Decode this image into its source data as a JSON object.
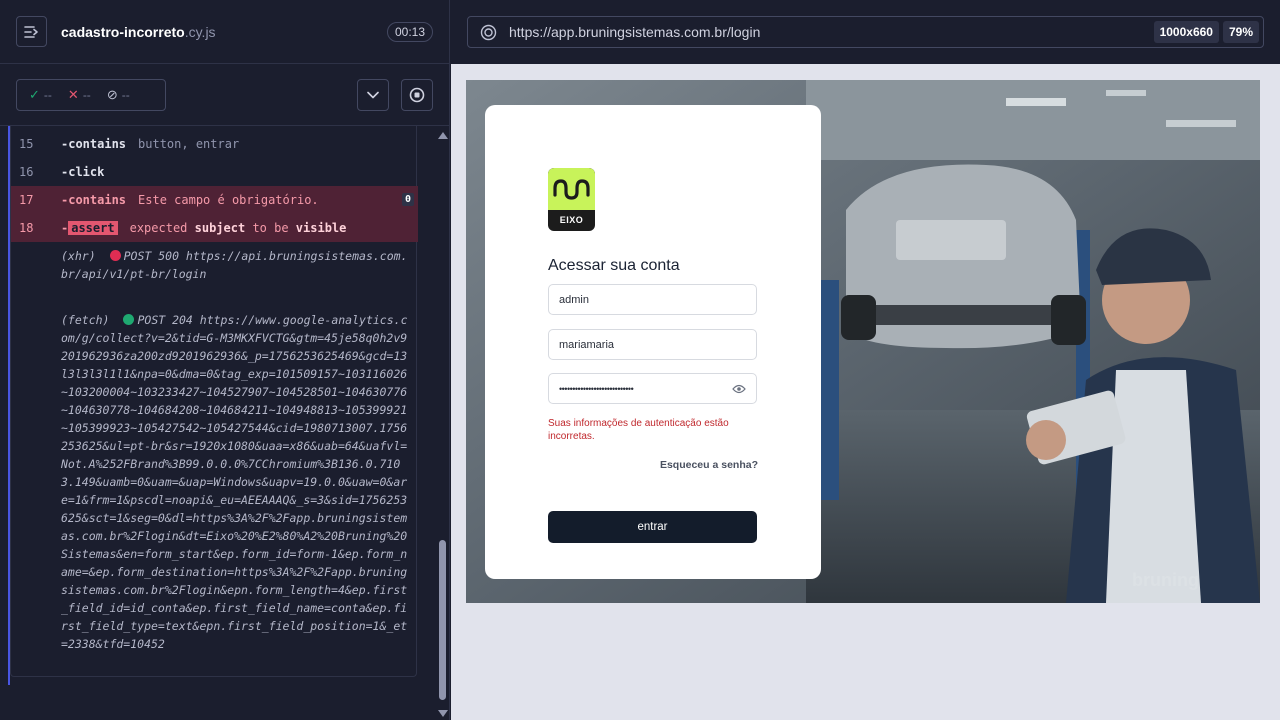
{
  "header": {
    "spec_name": "cadastro-incorreto",
    "spec_ext": ".cy.js",
    "duration": "00:13"
  },
  "stats": {
    "passed": "--",
    "failed": "--",
    "pending": "--"
  },
  "commands": [
    {
      "num": "15",
      "name": "-contains",
      "message": "button, entrar"
    },
    {
      "num": "16",
      "name": "-click",
      "message": ""
    },
    {
      "num": "17",
      "name": "-contains",
      "message": "Este campo é obrigatório.",
      "badge": "0"
    },
    {
      "num": "18",
      "name": "-",
      "assert_tag": "assert",
      "parts": [
        "expected",
        "subject",
        "to be",
        "visible"
      ]
    }
  ],
  "logs": [
    {
      "type": "(xhr)",
      "status_color": "#e02d53",
      "text": "POST 500 https://api.bruningsistemas.com.br/api/v1/pt-br/login"
    },
    {
      "type": "(fetch)",
      "status_color": "#1fa971",
      "text": "POST 204 https://www.google-analytics.com/g/collect?v=2&tid=G-M3MKXFVCTG&gtm=45je58q0h2v9201962936za200zd9201962936&_p=1756253625469&gcd=13l3l3l3l1l1&npa=0&dma=0&tag_exp=101509157~103116026~103200004~103233427~104527907~104528501~104630776~104630778~104684208~104684211~104948813~105399921~105399923~105427542~105427544&cid=1980713007.1756253625&ul=pt-br&sr=1920x1080&uaa=x86&uab=64&uafvl=Not.A%252FBrand%3B99.0.0.0%7CChromium%3B136.0.7103.149&uamb=0&uam=&uap=Windows&uapv=19.0.0&uaw=0&are=1&frm=1&pscdl=noapi&_eu=AEEAAAQ&_s=3&sid=1756253625&sct=1&seg=0&dl=https%3A%2F%2Fapp.bruningsistemas.com.br%2Flogin&dt=Eixo%20%E2%80%A2%20Bruning%20Sistemas&en=form_start&ep.form_id=form-1&ep.form_name=&ep.form_destination=https%3A%2F%2Fapp.bruningsistemas.com.br%2Flogin&epn.form_length=4&ep.first_field_id=id_conta&ep.first_field_name=conta&ep.first_field_type=text&epn.first_field_position=1&_et=2338&tfd=10452"
    }
  ],
  "browser": {
    "url": "https://app.bruningsistemas.com.br/login",
    "viewport": "1000x660",
    "zoom": "79%"
  },
  "login": {
    "logo_label": "EIXO",
    "title": "Acessar sua conta",
    "account": "admin",
    "username": "mariamaria",
    "password_mask": "••••••••••••••••••••••••••••",
    "error": "Suas informações de autenticação estão incorretas.",
    "forgot": "Esqueceu a senha?",
    "submit": "entrar",
    "watermark": "bruning"
  }
}
